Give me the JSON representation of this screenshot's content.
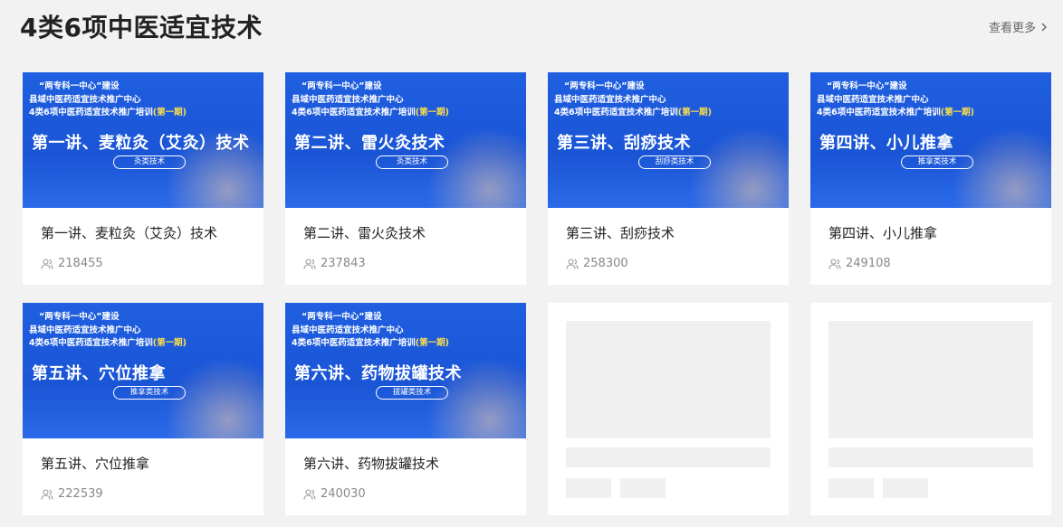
{
  "section": {
    "title": "4类6项中医适宜技术",
    "view_more": "查看更多"
  },
  "banner_common": {
    "line1": "“两专科一中心”建设",
    "line2": "县域中医药适宜技术推广中心",
    "line3_prefix": "4类6项中医药适宜技术推广培训",
    "line3_highlight": "(第一期)"
  },
  "courses": [
    {
      "banner_title": "第一讲、麦粒灸（艾灸）技术",
      "banner_tag": "灸类技术",
      "title": "第一讲、麦粒灸（艾灸）技术",
      "views": "218455"
    },
    {
      "banner_title": "第二讲、雷火灸技术",
      "banner_tag": "灸类技术",
      "title": "第二讲、雷火灸技术",
      "views": "237843"
    },
    {
      "banner_title": "第三讲、刮痧技术",
      "banner_tag": "刮痧类技术",
      "title": "第三讲、刮痧技术",
      "views": "258300"
    },
    {
      "banner_title": "第四讲、小儿推拿",
      "banner_tag": "推拿类技术",
      "title": "第四讲、小儿推拿",
      "views": "249108"
    },
    {
      "banner_title": "第五讲、穴位推拿",
      "banner_tag": "推拿类技术",
      "title": "第五讲、穴位推拿",
      "views": "222539"
    },
    {
      "banner_title": "第六讲、药物拔罐技术",
      "banner_tag": "拔罐类技术",
      "title": "第六讲、药物拔罐技术",
      "views": "240030"
    }
  ],
  "icons": {
    "view_more": "chevron-right-icon",
    "views": "users-icon"
  },
  "colors": {
    "banner_blue": "#1f5fe0",
    "highlight_yellow": "#ffe04a",
    "background": "#f2f2f2"
  }
}
